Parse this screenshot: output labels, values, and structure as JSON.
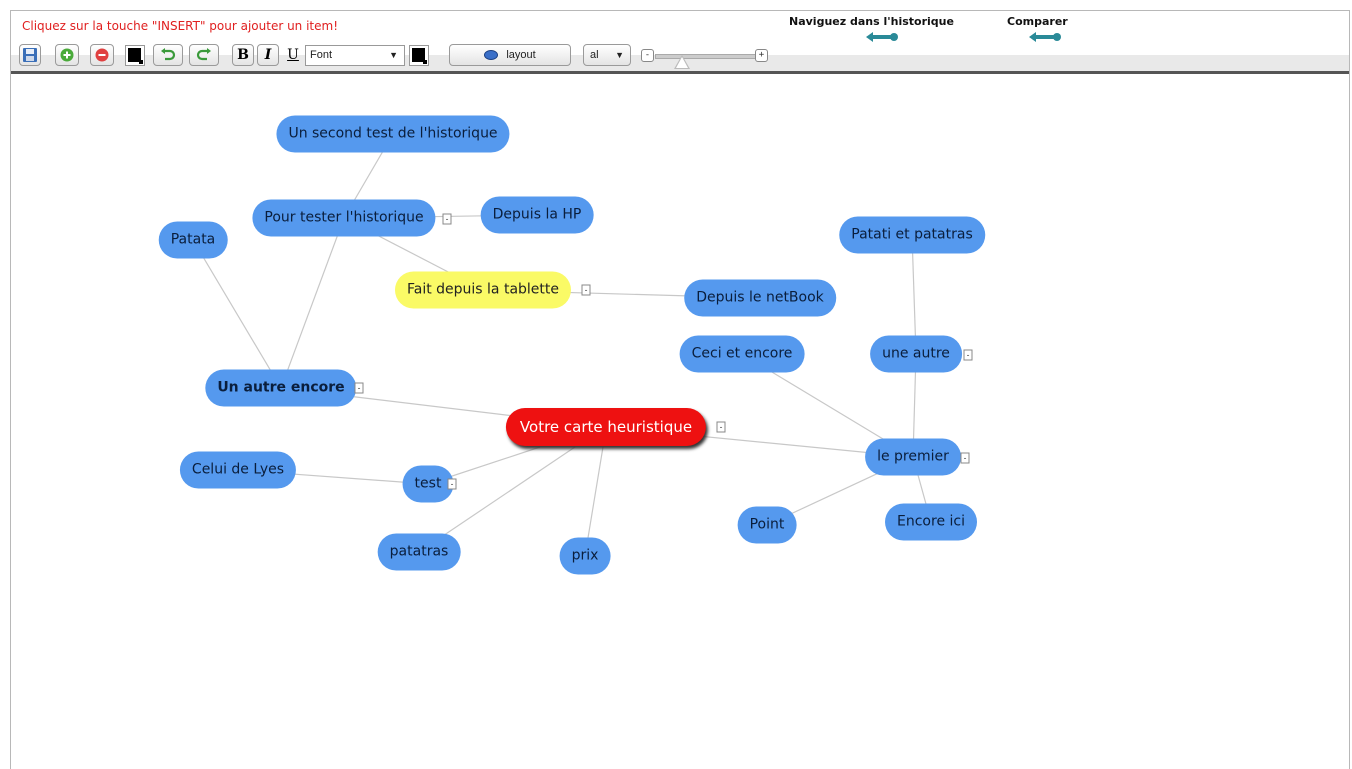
{
  "hint_text": "Cliquez sur la touche \"INSERT\" pour ajouter un item!",
  "history": {
    "label": "Naviguez dans l'historique"
  },
  "compare": {
    "label": "Comparer"
  },
  "toolbar": {
    "save_icon": "save-icon",
    "add_icon": "add-icon",
    "remove_icon": "remove-icon",
    "bold_label": "B",
    "italic_label": "I",
    "underline_label": "U",
    "font_value": "Font",
    "layout_label": "layout",
    "align_value": "al",
    "zoom_minus": "-",
    "zoom_plus": "+",
    "zoom_level": 0.28,
    "text_color": "#000000",
    "fill_color": "#000000"
  },
  "colors": {
    "node_blue": "#5599ee",
    "node_yellow": "#fafa66",
    "root_red": "#ee1111",
    "hint_red": "#e02020",
    "arrow_teal": "#2a8a98",
    "link_gray": "#c8c8c8"
  },
  "map": {
    "root": "Votre carte heuristique",
    "nodes": [
      "Un second test de l'historique",
      "Pour tester l'historique",
      "Depuis la HP",
      "Patata",
      "Fait depuis la tablette",
      "Depuis le netBook",
      "Patati et patatras",
      "Ceci et encore",
      "une autre",
      "Un autre encore",
      "le premier",
      "Celui de Lyes",
      "test",
      "Point",
      "Encore ici",
      "patatras",
      "prix"
    ],
    "toggle_symbol": "-"
  }
}
